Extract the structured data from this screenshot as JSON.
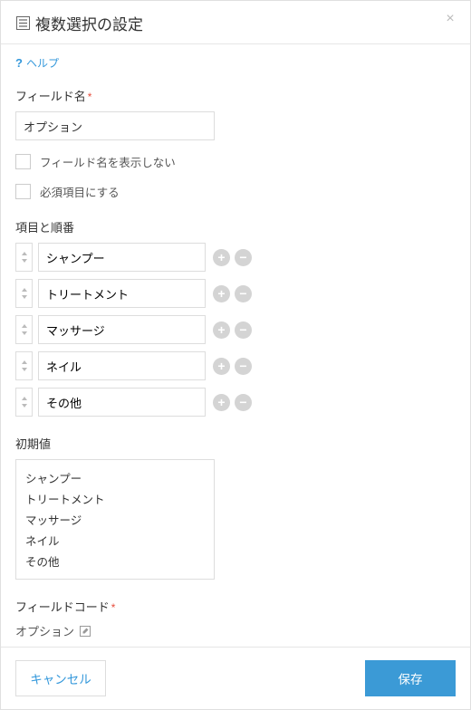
{
  "header": {
    "title": "複数選択の設定"
  },
  "help": {
    "text": "ヘルプ"
  },
  "field_name": {
    "label": "フィールド名",
    "value": "オプション"
  },
  "checkboxes": {
    "hide_label": "フィールド名を表示しない",
    "required": "必須項目にする"
  },
  "items_section": {
    "label": "項目と順番",
    "items": [
      {
        "value": "シャンプー"
      },
      {
        "value": "トリートメント"
      },
      {
        "value": "マッサージ"
      },
      {
        "value": "ネイル"
      },
      {
        "value": "その他"
      }
    ]
  },
  "default_section": {
    "label": "初期値",
    "options": [
      "シャンプー",
      "トリートメント",
      "マッサージ",
      "ネイル",
      "その他"
    ]
  },
  "fieldcode": {
    "label": "フィールドコード",
    "value": "オプション"
  },
  "footer": {
    "cancel": "キャンセル",
    "save": "保存"
  }
}
